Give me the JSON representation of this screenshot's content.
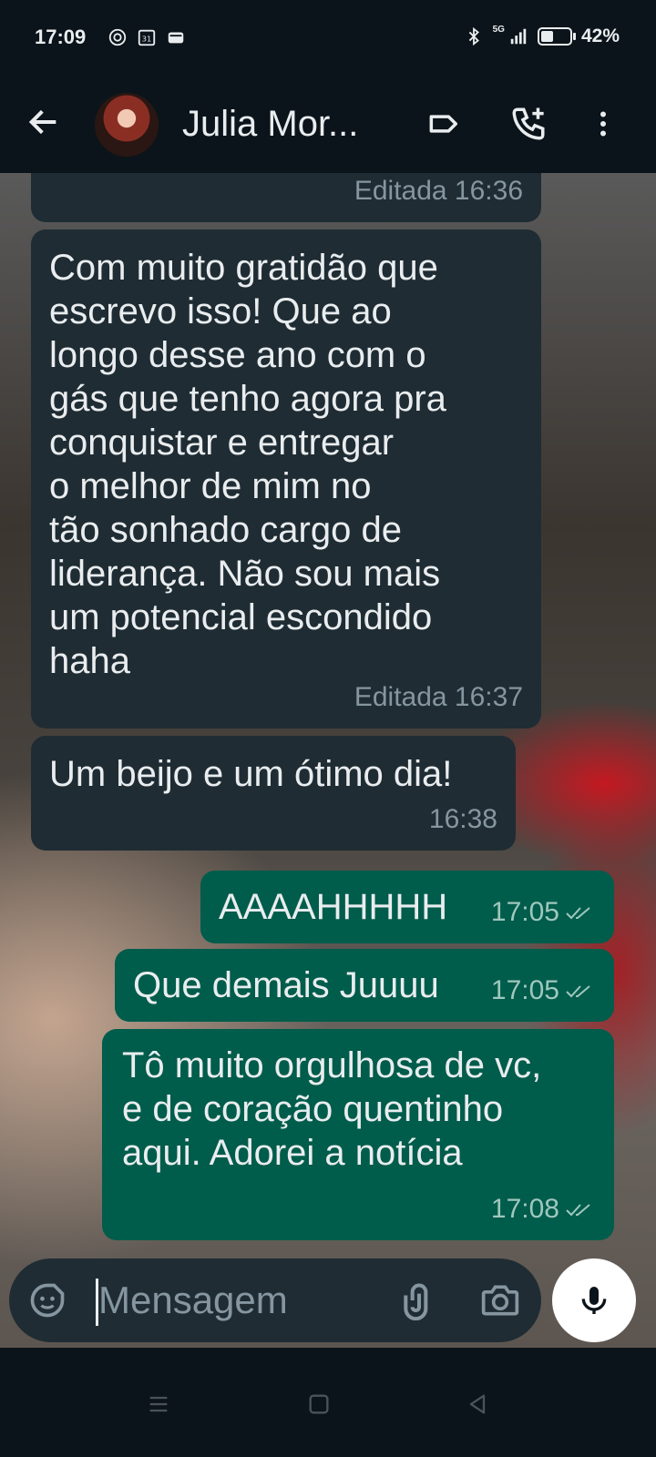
{
  "status_bar": {
    "time": "17:09",
    "network": "5G",
    "battery_text": "42%",
    "battery_level": 0.42,
    "icons": [
      "whatsapp-status-icon",
      "calendar-icon",
      "wallet-icon",
      "bluetooth-icon",
      "signal-icon",
      "battery-icon"
    ]
  },
  "header": {
    "contact_name": "Julia Mor...",
    "icons": [
      "back-arrow-icon",
      "label-icon",
      "add-call-icon",
      "more-vert-icon"
    ]
  },
  "messages": [
    {
      "direction": "in",
      "text": "",
      "time": "Editada 16:36"
    },
    {
      "direction": "in",
      "text": "Com muito gratidão que\nescrevo isso! Que ao\nlongo desse ano com o\ngás que tenho agora pra\nconquistar e entregar\no melhor de mim no\ntão sonhado cargo de\nliderança. Não sou mais\num potencial escondido\nhaha",
      "time": "Editada 16:37"
    },
    {
      "direction": "in",
      "text": "Um beijo e um ótimo dia!",
      "time": "16:38"
    },
    {
      "direction": "out",
      "text": "AAAAHHHHH",
      "time": "17:05",
      "status": "read"
    },
    {
      "direction": "out",
      "text": "Que demais Juuuu",
      "time": "17:05",
      "status": "read"
    },
    {
      "direction": "out",
      "text": "Tô muito orgulhosa de vc,\ne de coração quentinho\naqui. Adorei a notícia",
      "time": "17:08",
      "status": "read"
    }
  ],
  "composer": {
    "placeholder": "Mensagem",
    "icons": [
      "emoji-sticker-icon",
      "attach-icon",
      "camera-icon",
      "mic-icon"
    ]
  },
  "colors": {
    "background": "#0b141a",
    "incoming_bubble": "#1f2c33",
    "outgoing_bubble": "#005c4b",
    "meta_text": "#8696a0"
  }
}
